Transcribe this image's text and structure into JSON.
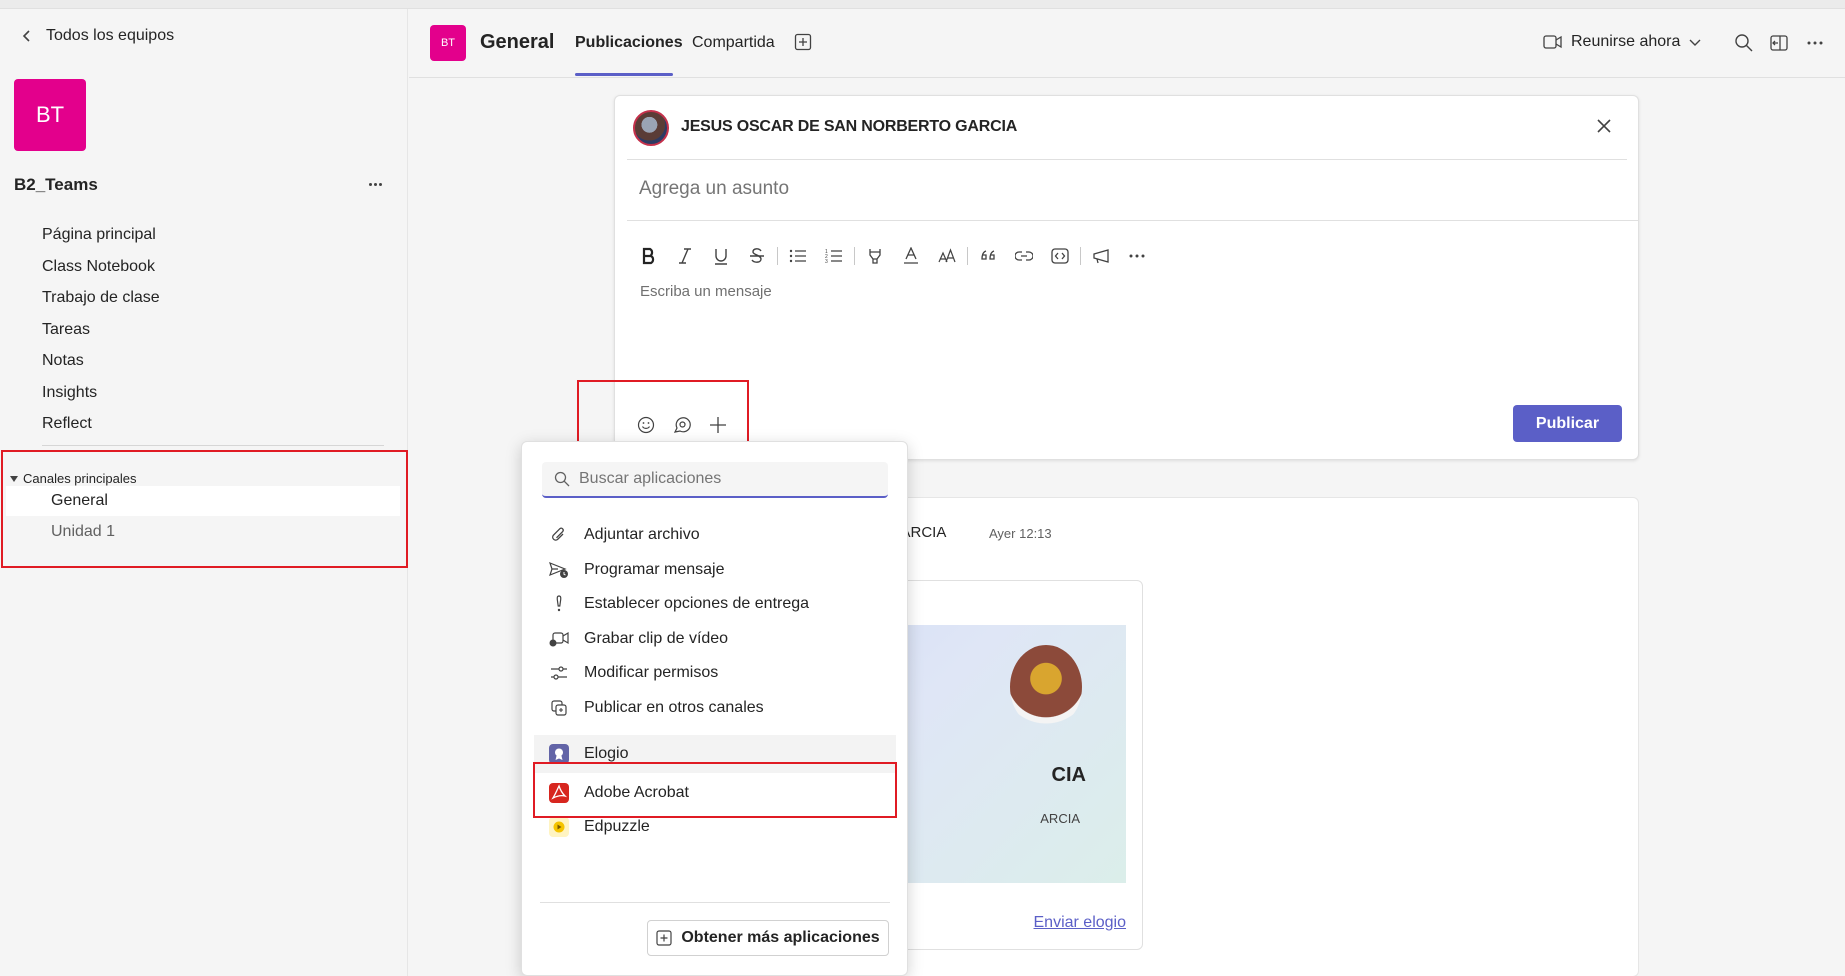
{
  "sidebar": {
    "back_label": "Todos los equipos",
    "team_initials": "BT",
    "team_name": "B2_Teams",
    "team_color": "#e3008c",
    "nav_items": [
      {
        "label": "Página principal"
      },
      {
        "label": "Class Notebook"
      },
      {
        "label": "Trabajo de clase"
      },
      {
        "label": "Tareas"
      },
      {
        "label": "Notas"
      },
      {
        "label": "Insights"
      },
      {
        "label": "Reflect"
      }
    ],
    "channels_header": "Canales principales",
    "channels": [
      {
        "label": "General",
        "active": true
      },
      {
        "label": "Unidad 1",
        "active": false
      }
    ]
  },
  "header": {
    "channel_initials": "BT",
    "channel_name": "General",
    "tabs": [
      {
        "label": "Publicaciones",
        "active": true
      },
      {
        "label": "Compartida",
        "active": false
      }
    ],
    "meet_label": "Reunirse ahora"
  },
  "composer": {
    "author": "JESUS OSCAR DE SAN NORBERTO GARCIA",
    "subject_placeholder": "Agrega un asunto",
    "message_placeholder": "Escriba un mensaje",
    "publish_label": "Publicar",
    "toolbar": [
      "bold-icon",
      "italic-icon",
      "underline-icon",
      "strikethrough-icon",
      "bullet-list-icon",
      "numbered-list-icon",
      "highlight-icon",
      "font-color-icon",
      "font-size-icon",
      "quote-icon",
      "link-icon",
      "code-icon",
      "announcement-icon",
      "more-options-icon"
    ]
  },
  "post": {
    "author_fragment": "O GARCIA",
    "time": "Ayer 12:13",
    "praise_title_fragment": "CIA",
    "praise_sub_fragment": "ARCIA",
    "praise_link": "Enviar elogio"
  },
  "popup": {
    "search_placeholder": "Buscar aplicaciones",
    "items": [
      {
        "label": "Adjuntar archivo",
        "icon": "paperclip-icon"
      },
      {
        "label": "Programar mensaje",
        "icon": "schedule-send-icon"
      },
      {
        "label": "Establecer opciones de entrega",
        "icon": "exclamation-icon"
      },
      {
        "label": "Grabar clip de vídeo",
        "icon": "video-clip-icon"
      },
      {
        "label": "Modificar permisos",
        "icon": "permissions-icon"
      },
      {
        "label": "Publicar en otros canales",
        "icon": "cross-post-icon"
      }
    ],
    "apps": [
      {
        "label": "Elogio",
        "icon": "praise-icon",
        "color": "#6264a7"
      },
      {
        "label": "Adobe Acrobat",
        "icon": "adobe-acrobat-icon",
        "color": "#d7261f"
      },
      {
        "label": "Edpuzzle",
        "icon": "edpuzzle-icon",
        "color": "#f5c400"
      }
    ],
    "more_apps_label": "Obtener más aplicaciones"
  },
  "colors": {
    "accent": "#5b5fc7",
    "highlight_box": "#e01b24"
  }
}
